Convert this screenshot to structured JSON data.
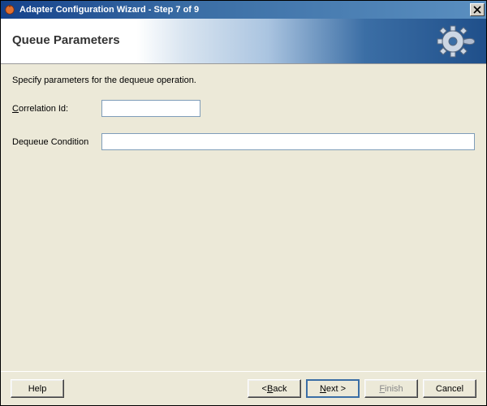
{
  "titlebar": {
    "text": "Adapter Configuration Wizard - Step 7 of 9"
  },
  "header": {
    "title": "Queue Parameters"
  },
  "content": {
    "instruction": "Specify parameters for the dequeue operation.",
    "correlation": {
      "prefix": "C",
      "rest": "orrelation Id:",
      "value": ""
    },
    "dequeue": {
      "label": "Dequeue Condition",
      "value": ""
    }
  },
  "footer": {
    "help": "Help",
    "back_lt": "< ",
    "back_u": "B",
    "back_rest": "ack",
    "next_u": "N",
    "next_rest": "ext >",
    "finish_u": "F",
    "finish_rest": "inish",
    "cancel": "Cancel"
  }
}
